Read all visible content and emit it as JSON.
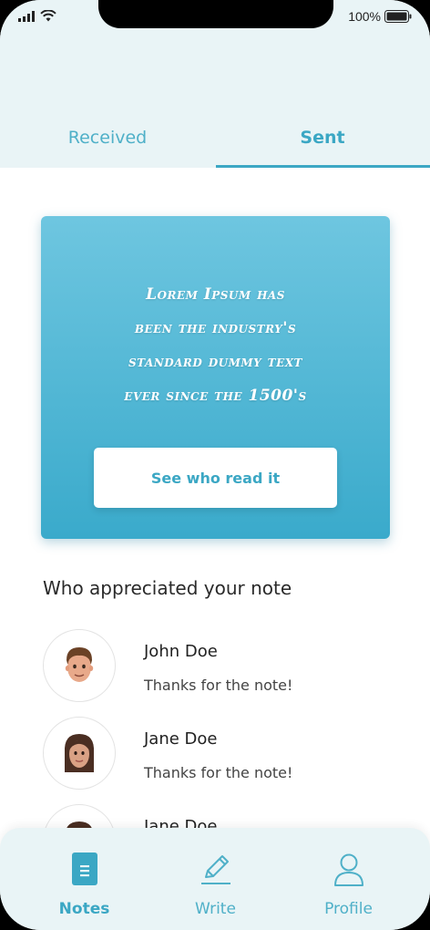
{
  "status_bar": {
    "battery_percent": "100%"
  },
  "tabs": [
    {
      "label": "Received",
      "active": false
    },
    {
      "label": "Sent",
      "active": true
    }
  ],
  "note": {
    "lines": [
      "Lorem Ipsum has",
      "been the industry's",
      "standard dummy text",
      "ever since the 1500's"
    ],
    "button_label": "See who read it"
  },
  "appreciations": {
    "title": "Who appreciated your note",
    "people": [
      {
        "name": "John Doe",
        "message": "Thanks for the note!",
        "avatar": "man-avatar"
      },
      {
        "name": "Jane Doe",
        "message": "Thanks for the note!",
        "avatar": "woman-avatar"
      },
      {
        "name": "Jane Doe",
        "message": "",
        "avatar": "woman-avatar"
      }
    ]
  },
  "bottom_nav": [
    {
      "label": "Notes",
      "icon": "document-icon",
      "active": true
    },
    {
      "label": "Write",
      "icon": "pencil-icon",
      "active": false
    },
    {
      "label": "Profile",
      "icon": "user-icon",
      "active": false
    }
  ],
  "colors": {
    "accent": "#3ba7c4",
    "header_bg": "#e9f4f6",
    "card_gradient_top": "#6ec6e0",
    "card_gradient_bottom": "#3aaacb"
  }
}
